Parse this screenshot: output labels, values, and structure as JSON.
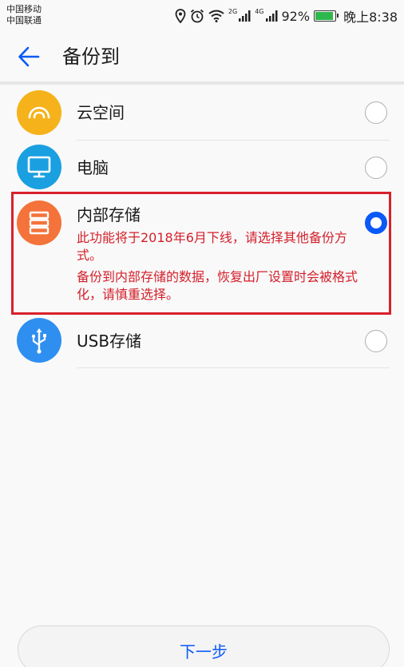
{
  "status_bar": {
    "carrier_1": "中国移动",
    "carrier_2": "中国联通",
    "network_1": "2G",
    "network_2": "4G",
    "battery": "92%",
    "time": "晚上8:38"
  },
  "header": {
    "title": "备份到"
  },
  "options": [
    {
      "label": "云空间",
      "icon": "cloud-icon",
      "color": "#f5b21a",
      "selected": false
    },
    {
      "label": "电脑",
      "icon": "monitor-icon",
      "color": "#1aa0e0",
      "selected": false
    },
    {
      "label": "内部存储",
      "icon": "storage-icon",
      "color": "#f4733a",
      "selected": true
    },
    {
      "label": "USB存储",
      "icon": "usb-icon",
      "color": "#2f8ff0",
      "selected": false
    }
  ],
  "warning": {
    "line_1": "此功能将于2018年6月下线，请选择其他备份方式。",
    "line_2": "备份到内部存储的数据，恢复出厂设置时会被格式化，请慎重选择。"
  },
  "footer": {
    "next_label": "下一步"
  },
  "colors": {
    "accent": "#0a59f7",
    "warning": "#d31f2a"
  }
}
